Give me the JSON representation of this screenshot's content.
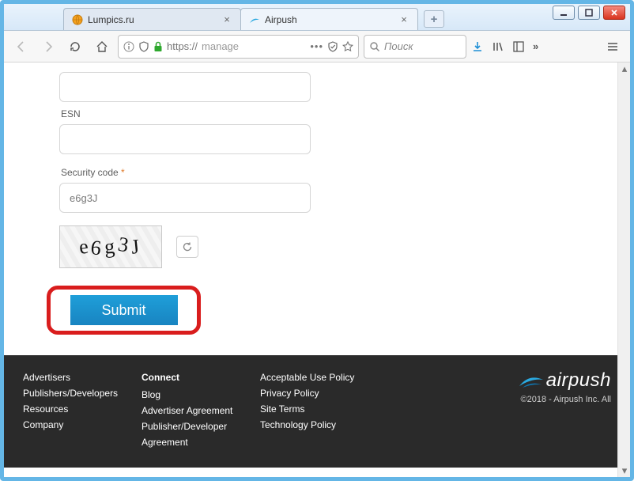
{
  "window": {
    "tabs": [
      {
        "title": "Lumpics.ru",
        "active": false
      },
      {
        "title": "Airpush",
        "active": true
      }
    ]
  },
  "url": {
    "protocol": "https://",
    "host": "manage"
  },
  "search": {
    "placeholder": "Поиск"
  },
  "form": {
    "esn_label": "ESN",
    "esn_value": "",
    "security_label": "Security code",
    "security_required_star": "*",
    "security_value": "e6g3J",
    "captcha_chars": [
      "e",
      "6",
      "g",
      "3",
      "J"
    ],
    "submit_label": "Submit"
  },
  "footer": {
    "col1": [
      "Advertisers",
      "Publishers/Developers",
      "Resources",
      "Company"
    ],
    "col2_head": "Connect",
    "col2": [
      "Blog",
      "Advertiser Agreement",
      "Publisher/Developer Agreement"
    ],
    "col3": [
      "Acceptable Use Policy",
      "Privacy Policy",
      "Site Terms",
      "Technology Policy"
    ],
    "brand": "airpush",
    "copyright": "©2018 - Airpush Inc. All"
  }
}
